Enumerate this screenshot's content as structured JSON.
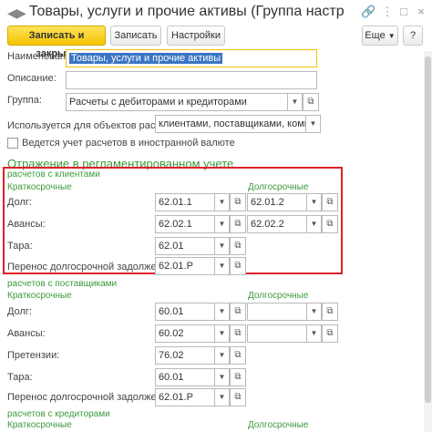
{
  "title": "Товары, услуги и прочие активы (Группа настроек финанс",
  "toolbar": {
    "save_close": "Записать и закрыть",
    "save": "Записать",
    "settings": "Настройки",
    "more": "Еще",
    "help": "?"
  },
  "form": {
    "name_label": "Наименование:",
    "name_value": "Товары, услуги и прочие активы",
    "desc_label": "Описание:",
    "desc_value": "",
    "group_label": "Группа:",
    "group_value": "Расчеты с дебиторами и кредиторами",
    "used_label": "Используется для объектов расчетов с:",
    "used_value": "клиентами, поставщиками, комиссионер",
    "currency_label": "Ведется учет расчетов в иностранной валюте"
  },
  "reg_accounting": {
    "title": "Отражение в регламентированном учете",
    "groups": [
      {
        "title": "расчетов с клиентами",
        "short_label": "Краткосрочные",
        "long_label": "Долгосрочные",
        "rows": [
          {
            "label": "Долг:",
            "short": "62.01.1",
            "long": "62.01.2"
          },
          {
            "label": "Авансы:",
            "short": "62.02.1",
            "long": "62.02.2"
          },
          {
            "label": "Тара:",
            "short": "62.01",
            "long": ""
          },
          {
            "label": "Перенос долгосрочной задолженности:",
            "short": "62.01.Р",
            "long": ""
          }
        ]
      },
      {
        "title": "расчетов с поставщиками",
        "short_label": "Краткосрочные",
        "long_label": "Долгосрочные",
        "rows": [
          {
            "label": "Долг:",
            "short": "60.01",
            "long": ""
          },
          {
            "label": "Авансы:",
            "short": "60.02",
            "long": ""
          },
          {
            "label": "Претензии:",
            "short": "76.02",
            "long": ""
          },
          {
            "label": "Тара:",
            "short": "60.01",
            "long": ""
          },
          {
            "label": "Перенос долгосрочной задолженности:",
            "short": "62.01.Р",
            "long": ""
          }
        ]
      },
      {
        "title": "расчетов с кредиторами",
        "short_label": "Краткосрочные",
        "long_label": "Долгосрочные",
        "rows": []
      }
    ]
  },
  "icons": {
    "back": "back-arrow-icon",
    "forward": "forward-arrow-icon",
    "link": "link-icon",
    "menu": "kebab-menu-icon",
    "maximize": "maximize-icon",
    "close": "close-icon",
    "dropdown": "dropdown-arrow-icon",
    "open": "open-icon"
  },
  "colors": {
    "primary_button": "#f4c400",
    "section_title": "#3c9a3c",
    "highlight_box": "#e0202a",
    "selection": "#3b74c4"
  }
}
